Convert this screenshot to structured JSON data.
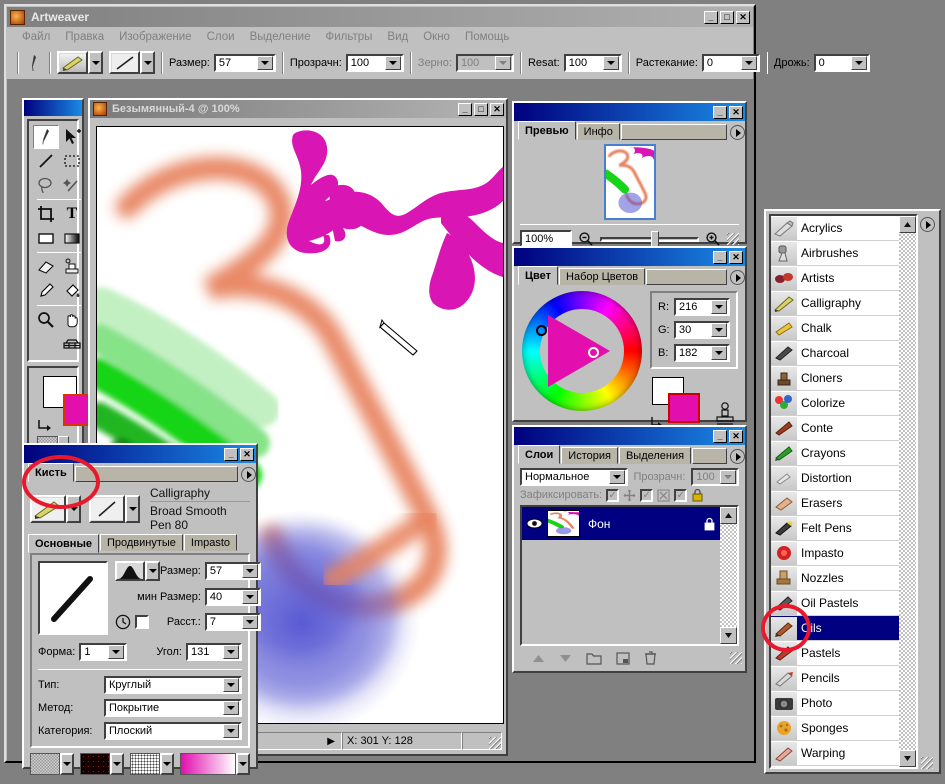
{
  "app": {
    "title": "Artweaver",
    "window_buttons": [
      "_",
      "□",
      "✕"
    ],
    "menus": [
      "Файл",
      "Правка",
      "Изображение",
      "Слои",
      "Выделение",
      "Фильтры",
      "Вид",
      "Окно",
      "Помощь"
    ]
  },
  "toolbar": {
    "fields": [
      {
        "label": "Размер:",
        "value": "57",
        "disabled": false
      },
      {
        "label": "Прозрачн:",
        "value": "100",
        "disabled": false
      },
      {
        "label": "Зерно:",
        "value": "100",
        "disabled": true
      },
      {
        "label": "Resat:",
        "value": "100",
        "disabled": false
      },
      {
        "label": "Растекание:",
        "value": "0",
        "disabled": false
      },
      {
        "label": "Дрожь:",
        "value": "0",
        "disabled": false
      }
    ]
  },
  "tools": {
    "items": [
      {
        "name": "brush-tool",
        "glyph": "brush",
        "selected": true
      },
      {
        "name": "move-tool",
        "glyph": "arrow-move",
        "selected": false
      },
      {
        "name": "line-tool",
        "glyph": "line",
        "selected": false
      },
      {
        "name": "rect-select-tool",
        "glyph": "marquee",
        "selected": false
      },
      {
        "name": "lasso-tool",
        "glyph": "lasso",
        "selected": false
      },
      {
        "name": "magic-wand-tool",
        "glyph": "wand",
        "selected": false
      },
      {
        "name": "crop-tool",
        "glyph": "crop",
        "selected": false
      },
      {
        "name": "text-tool",
        "glyph": "T",
        "selected": false
      },
      {
        "name": "fill-rect-tool",
        "glyph": "rect",
        "selected": false
      },
      {
        "name": "gradient-tool",
        "glyph": "gradient",
        "selected": false
      },
      {
        "name": "eraser-tool",
        "glyph": "eraser",
        "selected": false
      },
      {
        "name": "clone-tool",
        "glyph": "stamp",
        "selected": false
      },
      {
        "name": "eyedropper-tool",
        "glyph": "dropper",
        "selected": false
      },
      {
        "name": "bucket-tool",
        "glyph": "bucket",
        "selected": false
      },
      {
        "name": "zoom-tool",
        "glyph": "magnifier",
        "selected": false
      },
      {
        "name": "hand-tool",
        "glyph": "hand",
        "selected": false
      },
      {
        "name": "perspective-tool",
        "glyph": "grid",
        "selected": false
      }
    ],
    "foreground_color": "#ffffff",
    "background_color": "#e20eae"
  },
  "canvas_window": {
    "title": "Безымянный-4 @ 100%",
    "window_buttons": [
      "_",
      "□",
      "✕"
    ],
    "status": "X: 301  Y: 128"
  },
  "preview_panel": {
    "tabs": [
      {
        "label": "Превью",
        "active": true
      },
      {
        "label": "Инфо",
        "active": false
      }
    ],
    "zoom_value": "100%",
    "window_buttons": [
      "_",
      "✕"
    ]
  },
  "color_panel": {
    "tabs": [
      {
        "label": "Цвет",
        "active": true
      },
      {
        "label": "Набор Цветов",
        "active": false
      }
    ],
    "channels": [
      {
        "label": "R:",
        "value": "216"
      },
      {
        "label": "G:",
        "value": "30"
      },
      {
        "label": "B:",
        "value": "182"
      }
    ],
    "primary_color": "#e20eae",
    "secondary_color": "#ffffff",
    "window_buttons": [
      "_",
      "✕"
    ]
  },
  "layers_panel": {
    "tabs": [
      {
        "label": "Слои",
        "active": true
      },
      {
        "label": "История",
        "active": false
      },
      {
        "label": "Выделения",
        "active": false
      }
    ],
    "blend_mode": "Нормальное",
    "opacity_label": "Прозрачн:",
    "opacity_value": "100",
    "lock_label": "Зафиксировать:",
    "layers": [
      {
        "name": "Фон",
        "selected": true,
        "visible": true,
        "locked": true
      }
    ],
    "window_buttons": [
      "_",
      "✕"
    ]
  },
  "brush_panel": {
    "title": "",
    "tab_main": "Кисть",
    "window_buttons": [
      "_",
      "✕"
    ],
    "brush_family": "Calligraphy",
    "brush_variant": "Broad Smooth Pen 80",
    "tabs": [
      {
        "label": "Основные",
        "active": true
      },
      {
        "label": "Продвинутые",
        "active": false
      },
      {
        "label": "Impasto",
        "active": false
      }
    ],
    "fields": [
      {
        "label": "Размер:",
        "value": "57"
      },
      {
        "label": "мин Размер:",
        "value": "40"
      },
      {
        "label": "Расст.:",
        "value": "7"
      }
    ],
    "shape_field": {
      "label": "Форма:",
      "value": "1"
    },
    "angle_field": {
      "label": "Угол:",
      "value": "131"
    },
    "selects": [
      {
        "label": "Тип:",
        "value": "Круглый"
      },
      {
        "label": "Метод:",
        "value": "Покрытие"
      },
      {
        "label": "Категория:",
        "value": "Плоский"
      }
    ],
    "gradient_swatch": "#e20eae"
  },
  "brush_categories": {
    "items": [
      {
        "label": "Acrylics",
        "selected": false
      },
      {
        "label": "Airbrushes",
        "selected": false
      },
      {
        "label": "Artists",
        "selected": false
      },
      {
        "label": "Calligraphy",
        "selected": false
      },
      {
        "label": "Chalk",
        "selected": false
      },
      {
        "label": "Charcoal",
        "selected": false
      },
      {
        "label": "Cloners",
        "selected": false
      },
      {
        "label": "Colorize",
        "selected": false
      },
      {
        "label": "Conte",
        "selected": false
      },
      {
        "label": "Crayons",
        "selected": false
      },
      {
        "label": "Distortion",
        "selected": false
      },
      {
        "label": "Erasers",
        "selected": false
      },
      {
        "label": "Felt Pens",
        "selected": false
      },
      {
        "label": "Impasto",
        "selected": false
      },
      {
        "label": "Nozzles",
        "selected": false
      },
      {
        "label": "Oil Pastels",
        "selected": false
      },
      {
        "label": "Oils",
        "selected": true
      },
      {
        "label": "Pastels",
        "selected": false
      },
      {
        "label": "Pencils",
        "selected": false
      },
      {
        "label": "Photo",
        "selected": false
      },
      {
        "label": "Sponges",
        "selected": false
      },
      {
        "label": "Warping",
        "selected": false
      }
    ]
  },
  "annotations": {
    "highlight_brush_selector": "red-ellipse",
    "highlight_oils_category": "red-ellipse"
  },
  "artwork": {
    "strokes": [
      {
        "color": "#e8835f",
        "name": "salmon-swirl"
      },
      {
        "color": "#1ed81e",
        "name": "green-brush"
      },
      {
        "color": "#d916b4",
        "name": "magenta-calligraphy"
      },
      {
        "color": "#5a5ad0",
        "name": "blue-spray"
      }
    ]
  }
}
